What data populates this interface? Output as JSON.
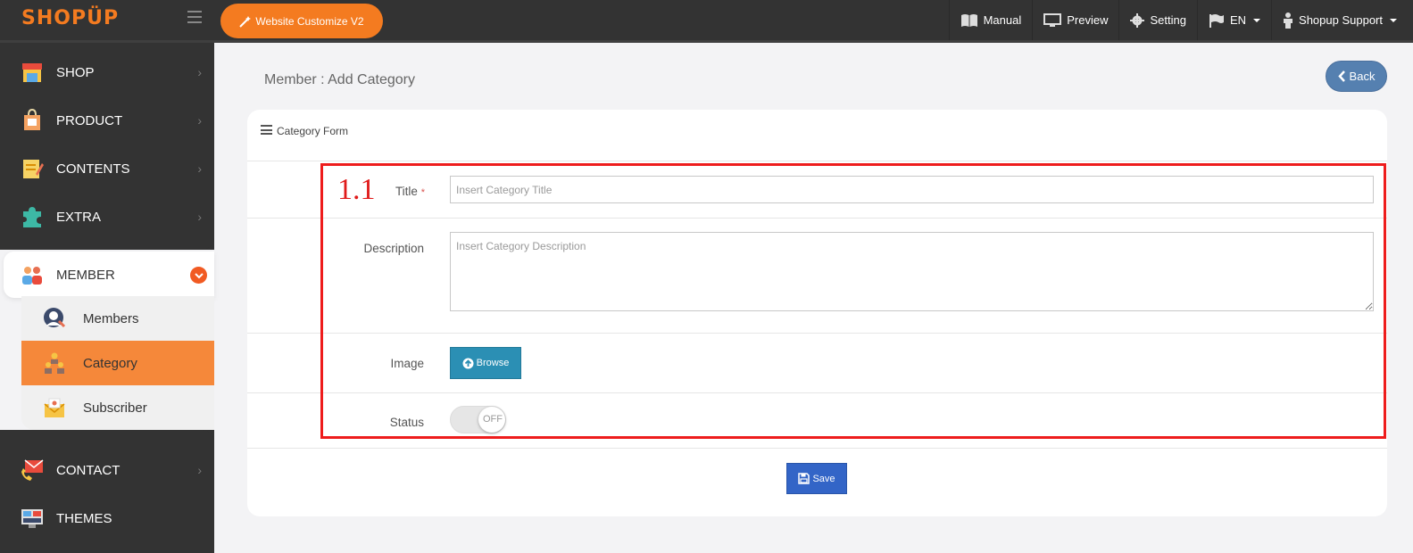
{
  "header": {
    "logo": "SHOPÜP",
    "customize_label": "Website Customize V2",
    "nav": [
      {
        "label": "Manual",
        "icon": "book-icon"
      },
      {
        "label": "Preview",
        "icon": "monitor-icon"
      },
      {
        "label": "Setting",
        "icon": "gear-icon"
      },
      {
        "label": "EN",
        "icon": "flag-icon"
      },
      {
        "label": "Shopup Support",
        "icon": "person-icon"
      }
    ]
  },
  "sidebar": {
    "items": [
      {
        "label": "SHOP"
      },
      {
        "label": "PRODUCT"
      },
      {
        "label": "CONTENTS"
      },
      {
        "label": "EXTRA"
      },
      {
        "label": "MEMBER"
      },
      {
        "label": "CONTACT"
      },
      {
        "label": "THEMES"
      }
    ],
    "member_sub": [
      {
        "label": "Members"
      },
      {
        "label": "Category"
      },
      {
        "label": "Subscriber"
      }
    ]
  },
  "main": {
    "page_title": "Member : Add Category",
    "back_label": "Back",
    "card_title": "Category Form",
    "form": {
      "title_label": "Title",
      "title_required": "*",
      "title_placeholder": "Insert Category Title",
      "description_label": "Description",
      "description_placeholder": "Insert Category Description",
      "image_label": "Image",
      "browse_label": "Browse",
      "status_label": "Status",
      "status_value": "OFF",
      "save_label": "Save"
    },
    "annotation": "1.1"
  },
  "colors": {
    "accent": "#f47b20",
    "topbar": "#333333",
    "active_sub": "#f5883a",
    "browse": "#2b8fb4",
    "save": "#3365c7",
    "back": "#5580b0",
    "annotation": "#ee1c1c"
  }
}
